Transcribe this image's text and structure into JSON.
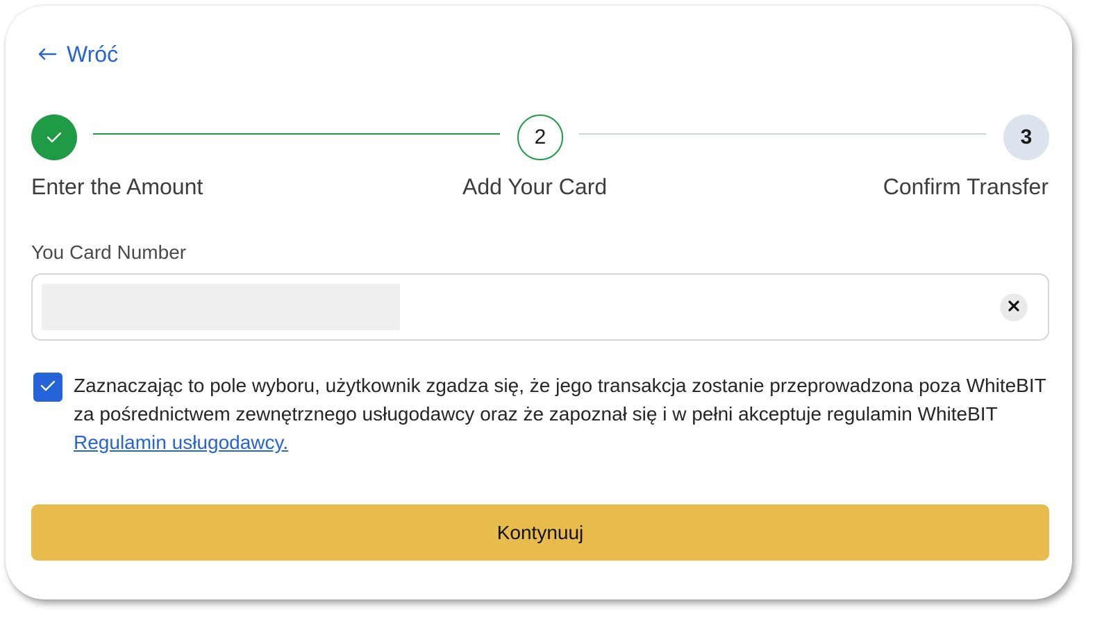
{
  "nav": {
    "back_label": "Wróć",
    "back_icon": "arrow-left-icon"
  },
  "stepper": {
    "steps": [
      {
        "number": "1",
        "label": "Enter the Amount",
        "state": "completed"
      },
      {
        "number": "2",
        "label": "Add Your Card",
        "state": "active"
      },
      {
        "number": "3",
        "label": "Confirm Transfer",
        "state": "pending"
      }
    ]
  },
  "card_field": {
    "label": "You Card Number",
    "value": "",
    "clear_icon": "close-icon"
  },
  "consent": {
    "checked": true,
    "text": "Zaznaczając to pole wyboru, użytkownik zgadza się, że jego transakcja zostanie przeprowadzona poza WhiteBIT za pośrednictwem zewnętrznego usługodawcy oraz że zapoznał się i w pełni akceptuje regulamin WhiteBIT ",
    "link_text": "Regulamin usługodawcy."
  },
  "actions": {
    "continue_label": "Kontynuuj"
  },
  "colors": {
    "accent_blue": "#2563d9",
    "success_green": "#1f9a45",
    "pending_gray": "#dce3ec",
    "button_yellow": "#e8bc4c"
  }
}
